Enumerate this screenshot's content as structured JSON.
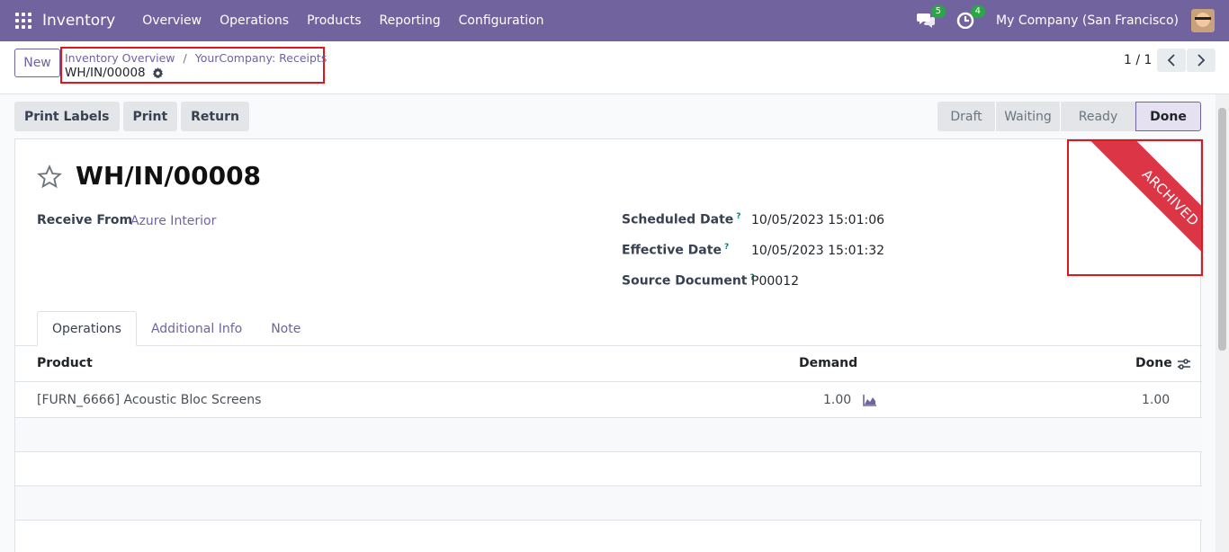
{
  "navbar": {
    "brand": "Inventory",
    "menu": [
      "Overview",
      "Operations",
      "Products",
      "Reporting",
      "Configuration"
    ],
    "messages_count": "5",
    "activities_count": "4",
    "company": "My Company (San Francisco)"
  },
  "control": {
    "new_label": "New",
    "breadcrumb": [
      "Inventory Overview",
      "YourCompany: Receipts"
    ],
    "current": "WH/IN/00008",
    "pager": "1 / 1"
  },
  "actions": [
    "Print Labels",
    "Print",
    "Return"
  ],
  "statusbar": {
    "stages": [
      "Draft",
      "Waiting",
      "Ready",
      "Done"
    ],
    "active": "Done"
  },
  "form": {
    "title": "WH/IN/00008",
    "ribbon": "ARCHIVED",
    "receive_from_label": "Receive From",
    "receive_from_value": "Azure Interior",
    "scheduled_date_label": "Scheduled Date",
    "scheduled_date_value": "10/05/2023 15:01:06",
    "effective_date_label": "Effective Date",
    "effective_date_value": "10/05/2023 15:01:32",
    "source_document_label": "Source Document",
    "source_document_value": "P00012",
    "help_mark": "?"
  },
  "tabs": [
    "Operations",
    "Additional Info",
    "Note"
  ],
  "table": {
    "headers": {
      "product": "Product",
      "demand": "Demand",
      "done": "Done"
    },
    "rows": [
      {
        "product": "[FURN_6666] Acoustic Bloc Screens",
        "demand": "1.00",
        "done": "1.00"
      }
    ]
  }
}
